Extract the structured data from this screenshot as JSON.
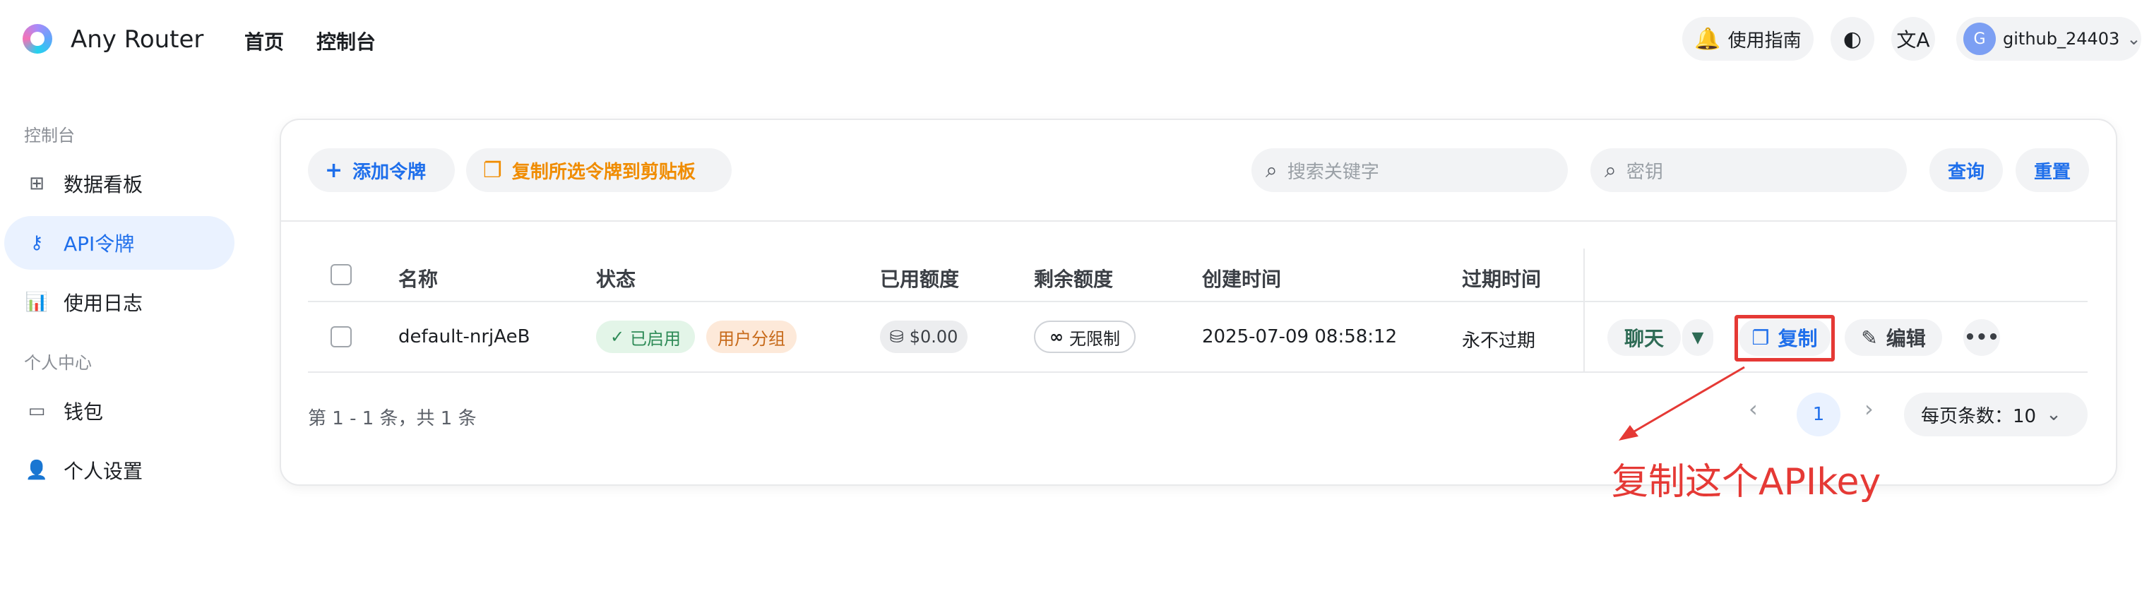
{
  "header": {
    "brand": "Any Router",
    "nav": [
      "首页",
      "控制台"
    ],
    "guide_label": "使用指南",
    "user_initial": "G",
    "username": "github_24403"
  },
  "sidebar": {
    "section1": "控制台",
    "items1": [
      {
        "label": "数据看板",
        "icon": "dashboard-icon"
      },
      {
        "label": "API令牌",
        "icon": "key-icon",
        "active": true
      },
      {
        "label": "使用日志",
        "icon": "chart-icon"
      }
    ],
    "section2": "个人中心",
    "items2": [
      {
        "label": "钱包",
        "icon": "wallet-icon"
      },
      {
        "label": "个人设置",
        "icon": "user-icon"
      }
    ]
  },
  "toolbar": {
    "add_label": "添加令牌",
    "copy_selected_label": "复制所选令牌到剪贴板",
    "search_placeholder": "搜索关键字",
    "key_placeholder": "密钥",
    "query_label": "查询",
    "reset_label": "重置"
  },
  "table": {
    "headers": [
      "名称",
      "状态",
      "已用额度",
      "剩余额度",
      "创建时间",
      "过期时间"
    ],
    "rows": [
      {
        "name": "default-nrjAeB",
        "status": "已启用",
        "group": "用户分组",
        "used": "$0.00",
        "remaining": "无限制",
        "created": "2025-07-09 08:58:12",
        "expires": "永不过期",
        "actions": {
          "chat": "聊天",
          "copy": "复制",
          "edit": "编辑"
        }
      }
    ]
  },
  "pagination": {
    "summary": "第 1 - 1 条，共 1 条",
    "current_page": "1",
    "page_size_label": "每页条数：10"
  },
  "annotation": "复制这个APIkey",
  "colors": {
    "primary": "#1f6feb",
    "orange": "#f08c00",
    "green": "#2e8b57",
    "red": "#e53935"
  }
}
